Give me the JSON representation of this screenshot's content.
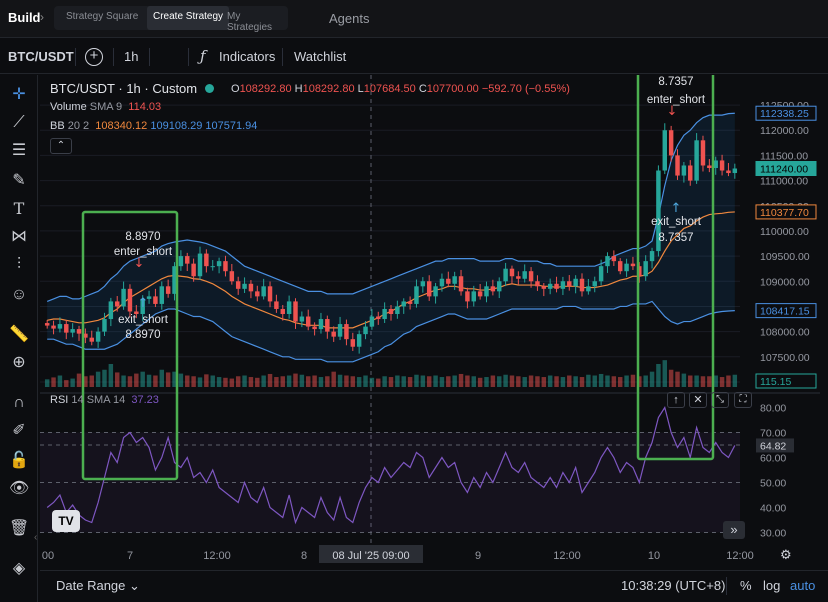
{
  "topbar": {
    "build": "Build",
    "tabs": [
      "Strategy Square",
      "Create Strategy",
      "My Strategies"
    ],
    "agents": "Agents"
  },
  "toolbar": {
    "symbol": "BTC/USDT",
    "interval": "1h",
    "indicators": "Indicators",
    "watchlist": "Watchlist"
  },
  "icons": [
    "crosshair-icon",
    "trend-line-icon",
    "horizontal-lines-icon",
    "brush-icon",
    "text-icon",
    "pattern-icon",
    "measure-icon",
    "emoji-icon",
    "ruler-icon",
    "zoom-icon",
    "magnet-icon",
    "lock-draw-icon",
    "lock-icon",
    "eye-icon",
    "trash-icon",
    "layers-icon"
  ],
  "legend": {
    "title": "BTC/USDT · 1h · Custom",
    "o_label": "O",
    "o": "108292.80",
    "h_label": "H",
    "h": "108292.80",
    "l_label": "L",
    "l": "107684.50",
    "c_label": "C",
    "c": "107700.00",
    "change": "−592.70 (−0.55%)",
    "volume_label": "Volume",
    "volume_sma": "SMA 9",
    "volume_value": "114.03",
    "bb_label": "BB",
    "bb_params": "20 2",
    "bb_mid": "108340.12",
    "bb_upper": "109108.29",
    "bb_lower": "107571.94",
    "rsi_label": "RSI",
    "rsi_params": "14 SMA 14",
    "rsi_value": "37.23"
  },
  "chart_data": {
    "type": "candlestick",
    "symbol": "BTC/USDT",
    "interval": "1h",
    "price_axis": {
      "ticks": [
        "112500.00",
        "112000.00",
        "111500.00",
        "111000.00",
        "110500.00",
        "110000.00",
        "109500.00",
        "109000.00",
        "108500.00",
        "108000.00",
        "107500.00",
        "107000.00"
      ],
      "range": [
        106900,
        112700
      ]
    },
    "price_badges": [
      {
        "value": "112338.25",
        "color": "#4a90e2"
      },
      {
        "value": "111240.00",
        "color": "#26a69a"
      },
      {
        "value": "110377.70",
        "color": "#f0883e"
      },
      {
        "value": "108417.15",
        "color": "#4a90e2"
      },
      {
        "value": "115.15",
        "color": "#26a69a"
      }
    ],
    "rsi_axis": {
      "ticks": [
        "80.00",
        "70.00",
        "60.00",
        "50.00",
        "40.00",
        "30.00"
      ],
      "range": [
        25,
        85
      ],
      "levels": [
        70,
        65,
        50,
        30
      ],
      "current": "64.82"
    },
    "time_axis": {
      "labels": [
        "00",
        "7",
        "12:00",
        "8",
        "08 Jul '25  09:00",
        "9",
        "12:00",
        "10",
        "12:00"
      ]
    },
    "closes": [
      108120,
      108060,
      108150,
      107980,
      108050,
      107960,
      107880,
      107800,
      108000,
      108250,
      108600,
      108500,
      108850,
      108400,
      108350,
      108650,
      108700,
      108550,
      108900,
      108750,
      109300,
      109500,
      109350,
      109100,
      109550,
      109300,
      109300,
      109400,
      109200,
      109000,
      108850,
      108950,
      108800,
      108700,
      108900,
      108600,
      108450,
      108350,
      108600,
      108200,
      108300,
      108100,
      108050,
      108250,
      108000,
      107900,
      108150,
      107850,
      107700,
      107950,
      108100,
      108300,
      108250,
      108450,
      108350,
      108500,
      108600,
      108550,
      108900,
      109000,
      108700,
      108900,
      109050,
      108950,
      109100,
      108800,
      108600,
      108800,
      108700,
      108900,
      108800,
      109000,
      109250,
      109100,
      109050,
      109200,
      109000,
      108900,
      108850,
      108950,
      108850,
      109000,
      108900,
      109050,
      108800,
      108900,
      109000,
      109300,
      109500,
      109400,
      109200,
      109350,
      109300,
      109100,
      109400,
      109600,
      111200,
      112000,
      111500,
      111100,
      111300,
      111000,
      111800,
      111300,
      111250,
      111400,
      111200,
      111150,
      111240
    ],
    "volumes": [
      20,
      25,
      30,
      18,
      22,
      35,
      28,
      30,
      40,
      45,
      60,
      38,
      30,
      28,
      35,
      40,
      32,
      30,
      45,
      38,
      40,
      35,
      30,
      28,
      25,
      33,
      30,
      26,
      24,
      22,
      28,
      30,
      26,
      24,
      30,
      34,
      26,
      28,
      30,
      35,
      32,
      28,
      30,
      26,
      28,
      40,
      32,
      30,
      28,
      26,
      30,
      24,
      22,
      28,
      26,
      30,
      28,
      26,
      32,
      30,
      28,
      30,
      26,
      28,
      30,
      34,
      30,
      28,
      24,
      26,
      30,
      28,
      32,
      30,
      28,
      26,
      30,
      28,
      26,
      30,
      28,
      26,
      30,
      28,
      26,
      32,
      30,
      34,
      30,
      28,
      26,
      30,
      32,
      28,
      30,
      40,
      60,
      70,
      45,
      40,
      35,
      30,
      30,
      28,
      28,
      30,
      26,
      30,
      32
    ],
    "rsi": [
      40,
      42,
      45,
      38,
      41,
      37,
      35,
      34,
      42,
      52,
      62,
      58,
      68,
      70,
      66,
      68,
      64,
      55,
      60,
      68,
      58,
      56,
      60,
      52,
      54,
      50,
      55,
      48,
      46,
      44,
      42,
      50,
      44,
      42,
      48,
      40,
      38,
      36,
      45,
      34,
      40,
      38,
      36,
      44,
      38,
      35,
      44,
      36,
      34,
      42,
      48,
      52,
      50,
      56,
      52,
      55,
      58,
      56,
      62,
      60,
      52,
      56,
      60,
      56,
      58,
      50,
      46,
      52,
      48,
      54,
      50,
      56,
      62,
      56,
      54,
      58,
      52,
      50,
      48,
      52,
      48,
      54,
      50,
      56,
      46,
      50,
      54,
      60,
      64,
      60,
      54,
      58,
      56,
      50,
      60,
      66,
      76,
      80,
      70,
      64,
      68,
      60,
      72,
      64,
      62,
      66,
      62,
      60,
      64.82
    ],
    "bb_upper": [
      108600,
      108650,
      108700,
      108700,
      108650,
      108650,
      108700,
      108750,
      108800,
      108900,
      109050,
      109150,
      109300,
      109400,
      109450,
      109500,
      109550,
      109600,
      109700,
      109750,
      109780,
      109800,
      109820,
      109800,
      109780,
      109750,
      109700,
      109650,
      109600,
      109500,
      109400,
      109300,
      109250,
      109200,
      109150,
      109100,
      109050,
      109000,
      108950,
      108900,
      108850,
      108800,
      108800,
      108800,
      108750,
      108750,
      108750,
      108750,
      108750,
      108800,
      108850,
      108900,
      108950,
      109000,
      109050,
      109100,
      109150,
      109200,
      109250,
      109300,
      109350,
      109400,
      109400,
      109450,
      109450,
      109450,
      109450,
      109450,
      109400,
      109400,
      109400,
      109400,
      109450,
      109450,
      109400,
      109400,
      109400,
      109400,
      109350,
      109350,
      109300,
      109300,
      109300,
      109300,
      109300,
      109300,
      109300,
      109350,
      109400,
      109500,
      109550,
      109600,
      109650,
      109650,
      109700,
      109800,
      110300,
      110900,
      111400,
      111700,
      111900,
      112000,
      112150,
      112250,
      112300,
      112300,
      112300,
      112330,
      112338
    ],
    "bb_lower": [
      107850,
      107850,
      107800,
      107750,
      107750,
      107700,
      107650,
      107650,
      107650,
      107650,
      107700,
      107750,
      107850,
      107950,
      108050,
      108150,
      108250,
      108350,
      108400,
      108450,
      108450,
      108400,
      108350,
      108300,
      108300,
      108250,
      108200,
      108100,
      108000,
      107900,
      107850,
      107800,
      107750,
      107700,
      107650,
      107600,
      107550,
      107500,
      107500,
      107450,
      107450,
      107450,
      107450,
      107450,
      107400,
      107400,
      107400,
      107400,
      107400,
      107450,
      107500,
      107550,
      107600,
      107700,
      107750,
      107850,
      107950,
      108000,
      108100,
      108150,
      108200,
      108250,
      108300,
      108350,
      108350,
      108300,
      108250,
      108250,
      108250,
      108250,
      108300,
      108350,
      108400,
      108450,
      108450,
      108450,
      108450,
      108450,
      108450,
      108450,
      108450,
      108500,
      108500,
      108500,
      108450,
      108450,
      108450,
      108450,
      108450,
      108450,
      108500,
      108500,
      108550,
      108550,
      108550,
      108600,
      108450,
      108300,
      108200,
      108150,
      108200,
      108200,
      108250,
      108300,
      108350,
      108380,
      108400,
      108410,
      108417
    ]
  },
  "signals": [
    {
      "label_top": "8.8970",
      "label": "enter_short",
      "label2": "exit_short",
      "label_bottom": "8.8970"
    },
    {
      "label_top": "8.7357",
      "label": "enter_short",
      "label2": "exit_short",
      "label_bottom": "8.7357"
    }
  ],
  "bottom": {
    "date_range": "Date Range",
    "time": "10:38:29 (UTC+8)",
    "percent": "%",
    "log": "log",
    "auto": "auto"
  },
  "colors": {
    "up": "#26a69a",
    "down": "#ef5350",
    "bb": "#4a90e2",
    "bb_mid": "#f0883e",
    "rsi": "#7e57c2",
    "highlight": "#4caf50"
  }
}
